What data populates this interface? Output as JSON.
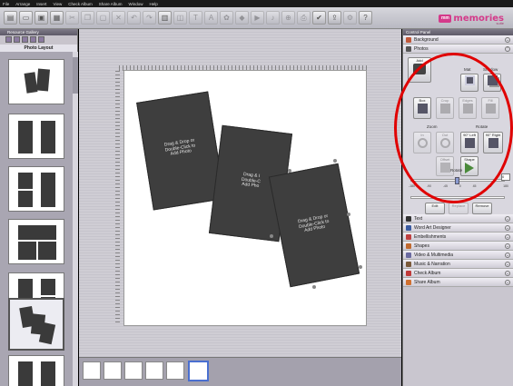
{
  "menubar": [
    "File",
    "Arrange",
    "Insert",
    "View",
    "Check Album",
    "Share Album",
    "Window",
    "Help"
  ],
  "brand": {
    "logo_text": "mm",
    "name": "memories",
    "sub": "suite"
  },
  "left_panel": {
    "title": "Resource Gallery",
    "subtitle": "Photo Layout"
  },
  "control_panel": {
    "title": "Control Panel",
    "sections_top": [
      {
        "label": "Background",
        "color": "#c0583a"
      },
      {
        "label": "Photos",
        "color": "#555555"
      }
    ],
    "photos": {
      "add_label": "Add",
      "mat_label": "Mat",
      "shadow_label": "Shadow",
      "row2": [
        "Box",
        "Crop",
        "Edges",
        "Fill"
      ],
      "zoom_label": "Zoom",
      "rotate_label": "Rotate",
      "zoom_in": "In",
      "zoom_out": "Out",
      "rotate_left": "90° Left",
      "rotate_right": "90° Right",
      "offset_label": "Offset",
      "shape_label": "Shape",
      "rotate_slider_label": "Rotate",
      "rotate_value": "0",
      "rotate_slider_level": 0.5,
      "ticks": [
        "-180",
        "-90",
        "-45",
        "0",
        "45",
        "90",
        "180"
      ],
      "edit_label": "Edit",
      "replace_label": "Replace",
      "remove_label": "Remove"
    },
    "sections_bottom": [
      {
        "label": "Text",
        "color": "#333333"
      },
      {
        "label": "Word Art Designer",
        "color": "#3a5aa0"
      },
      {
        "label": "Embellishments",
        "color": "#c04040"
      },
      {
        "label": "Shapes",
        "color": "#c06a30"
      },
      {
        "label": "Video & Multimedia",
        "color": "#6a6aa0"
      },
      {
        "label": "Music & Narration",
        "color": "#7a5a3a"
      },
      {
        "label": "Check Album",
        "color": "#c03a3a"
      },
      {
        "label": "Share Album",
        "color": "#d07030"
      }
    ]
  },
  "canvas": {
    "placeholder_1": "Drag & Drop or\nDouble-Click to\nAdd Photo",
    "placeholder_2": "Drag & I\nDouble-C\nAdd Pho",
    "placeholder_3": "Drag & Drop or\nDouble-Click to\nAdd Photo"
  },
  "annotation_color": "#e00000"
}
